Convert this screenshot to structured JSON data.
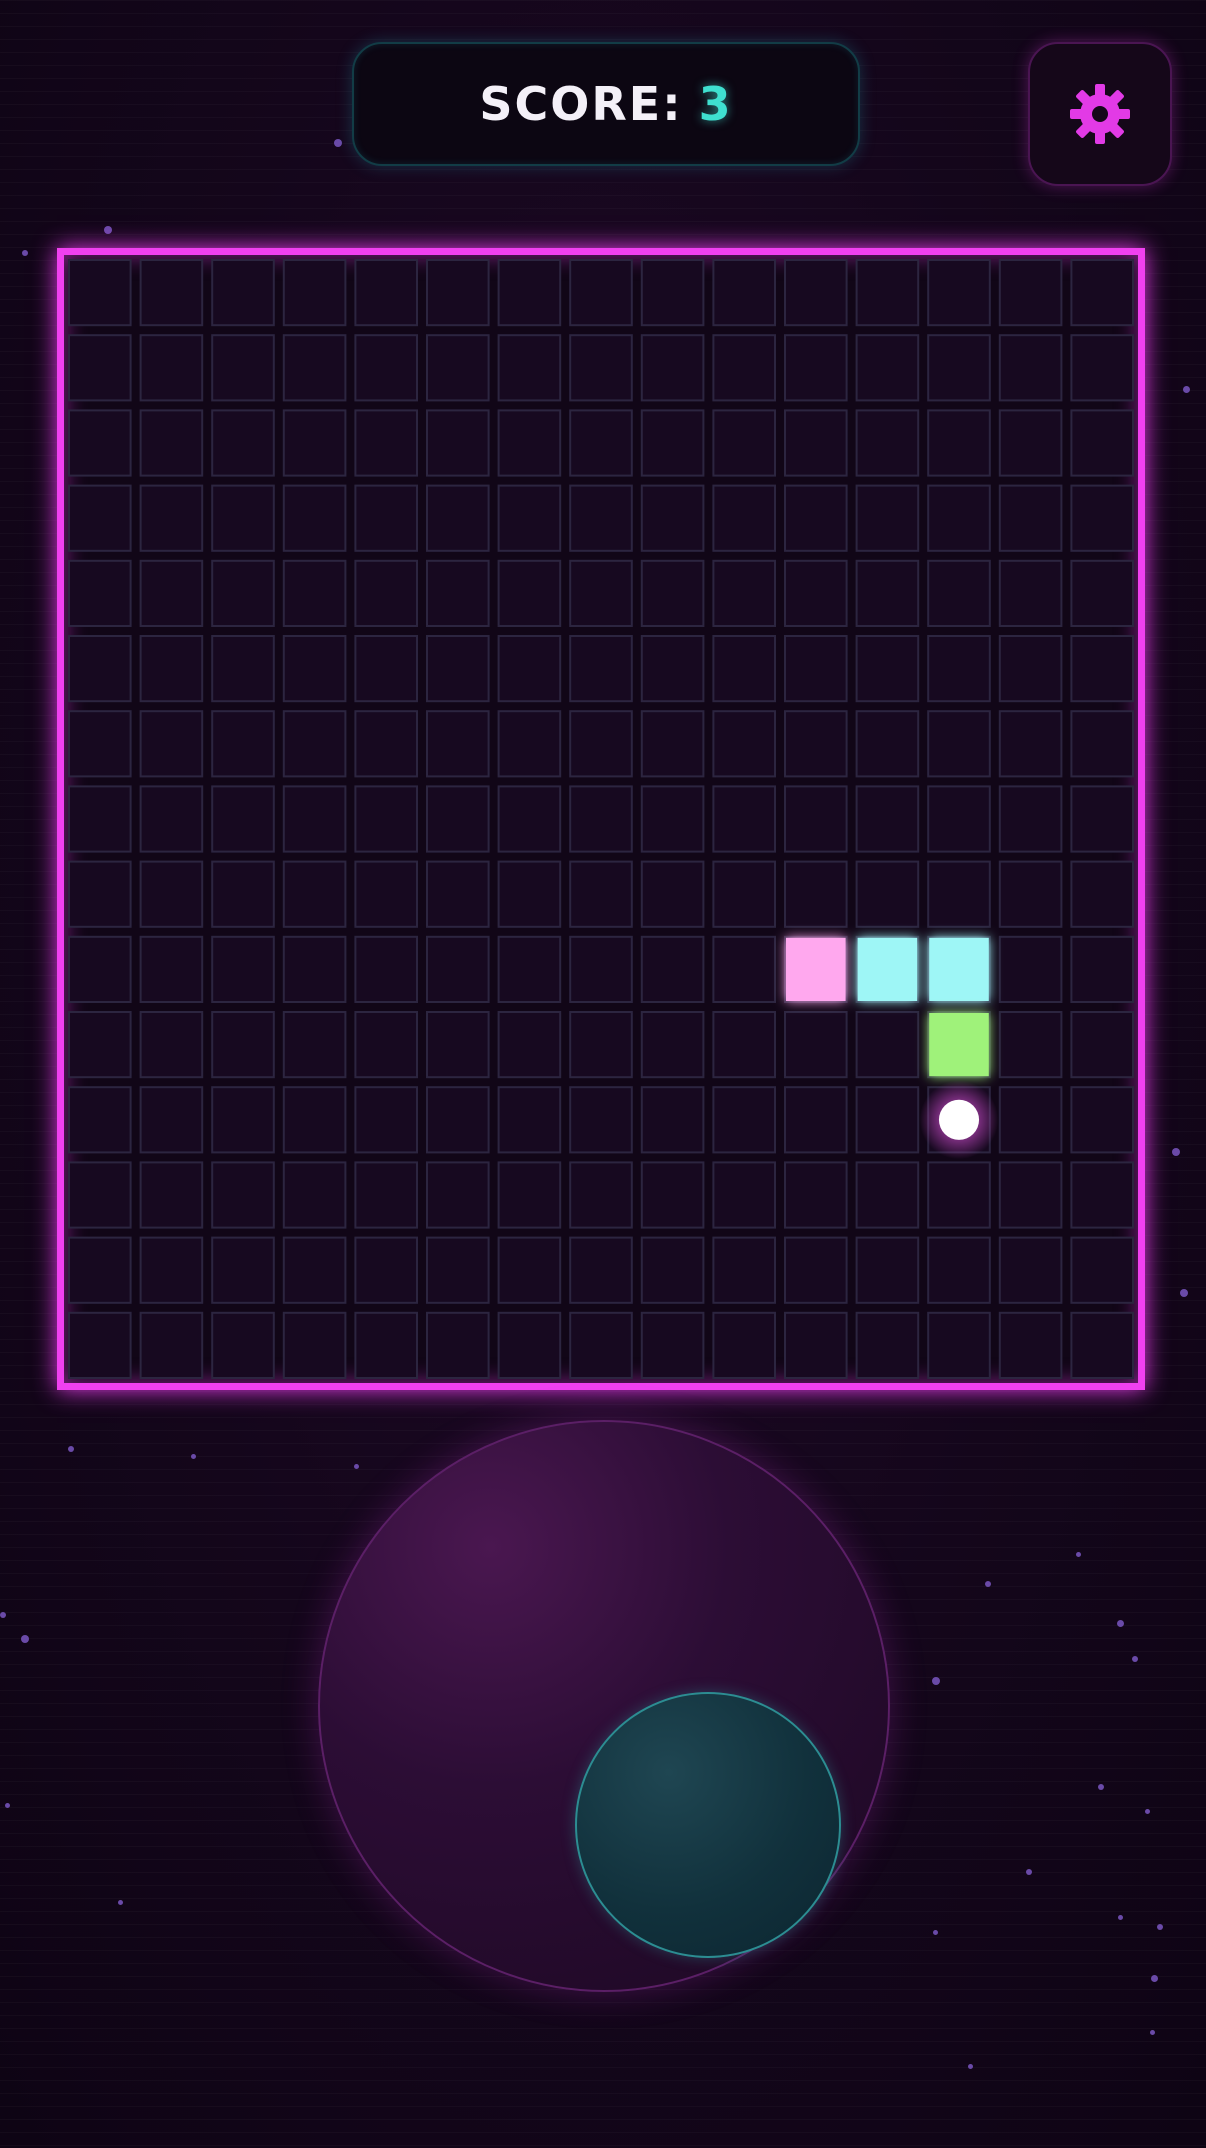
{
  "score": {
    "label": "SCORE:",
    "value": "3"
  },
  "settings": {
    "icon": "gear-icon"
  },
  "board": {
    "columns": 15,
    "rows": 15,
    "snake": [
      {
        "col": 10,
        "row": 9,
        "color": "#ffa8ee"
      },
      {
        "col": 11,
        "row": 9,
        "color": "#9ef6f6"
      },
      {
        "col": 12,
        "row": 9,
        "color": "#9ef6f6"
      },
      {
        "col": 12,
        "row": 10,
        "color": "#9ff27a"
      }
    ],
    "food": {
      "col": 12,
      "row": 11,
      "color": "#ffffff"
    }
  },
  "colors": {
    "border": "#f040f0",
    "accent": "#3fe0d0",
    "gear": "#e23ae6"
  }
}
